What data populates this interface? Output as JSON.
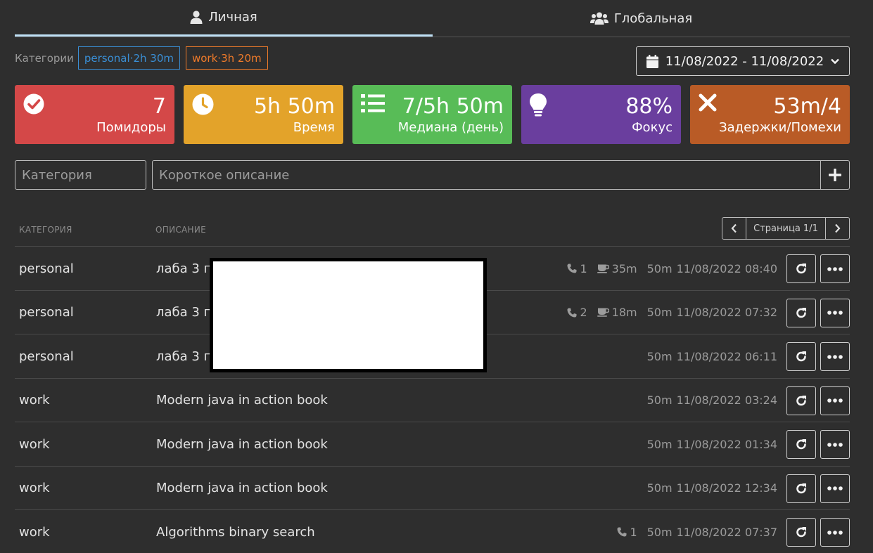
{
  "tabs": [
    {
      "label": "Личная",
      "icon": "user-icon",
      "active": true
    },
    {
      "label": "Глобальная",
      "icon": "users-icon",
      "active": false
    }
  ],
  "categories": {
    "label": "Категории",
    "items": [
      {
        "name": "personal",
        "time": "2h 30m",
        "color": "#3a8fd6"
      },
      {
        "name": "work",
        "time": "3h 20m",
        "color": "#f07b2a"
      }
    ]
  },
  "date_range": {
    "label": "11/08/2022 - 11/08/2022",
    "icon": "calendar-icon"
  },
  "stats": [
    {
      "value": "7",
      "caption": "Помидоры",
      "icon": "check-circle-icon",
      "color": "#d44848"
    },
    {
      "value": "5h 50m",
      "caption": "Время",
      "icon": "clock-icon",
      "color": "#e3a32a"
    },
    {
      "value": "7/5h 50m",
      "caption": "Медиана (день)",
      "icon": "list-icon",
      "color": "#58bc57"
    },
    {
      "value": "88%",
      "caption": "Фокус",
      "icon": "lightbulb-icon",
      "color": "#6a3e9e"
    },
    {
      "value": "53m/4",
      "caption": "Задержки/Помехи",
      "icon": "times-icon",
      "color": "#b95b26"
    }
  ],
  "form": {
    "category_placeholder": "Категория",
    "description_placeholder": "Короткое описание",
    "category_value": "",
    "description_value": ""
  },
  "table": {
    "headers": {
      "category": "КАТЕГОРИЯ",
      "description": "ОПИСАНИЕ"
    },
    "pager": {
      "label": "Страница 1/1"
    },
    "rows": [
      {
        "category": "personal",
        "description": "лаба 3 по",
        "calls": "1",
        "breaks": "35m",
        "duration": "50m",
        "datetime": "11/08/2022 08:40"
      },
      {
        "category": "personal",
        "description": "лаба 3 по",
        "calls": "2",
        "breaks": "18m",
        "duration": "50m",
        "datetime": "11/08/2022 07:32"
      },
      {
        "category": "personal",
        "description": "лаба 3 по",
        "calls": null,
        "breaks": null,
        "duration": "50m",
        "datetime": "11/08/2022 06:11"
      },
      {
        "category": "work",
        "description": "Modern java in action book",
        "calls": null,
        "breaks": null,
        "duration": "50m",
        "datetime": "11/08/2022 03:24"
      },
      {
        "category": "work",
        "description": "Modern java in action book",
        "calls": null,
        "breaks": null,
        "duration": "50m",
        "datetime": "11/08/2022 01:34"
      },
      {
        "category": "work",
        "description": "Modern java in action book",
        "calls": null,
        "breaks": null,
        "duration": "50m",
        "datetime": "11/08/2022 12:34"
      },
      {
        "category": "work",
        "description": "Algorithms binary search",
        "calls": "1",
        "breaks": null,
        "duration": "50m",
        "datetime": "11/08/2022 07:37"
      }
    ]
  }
}
